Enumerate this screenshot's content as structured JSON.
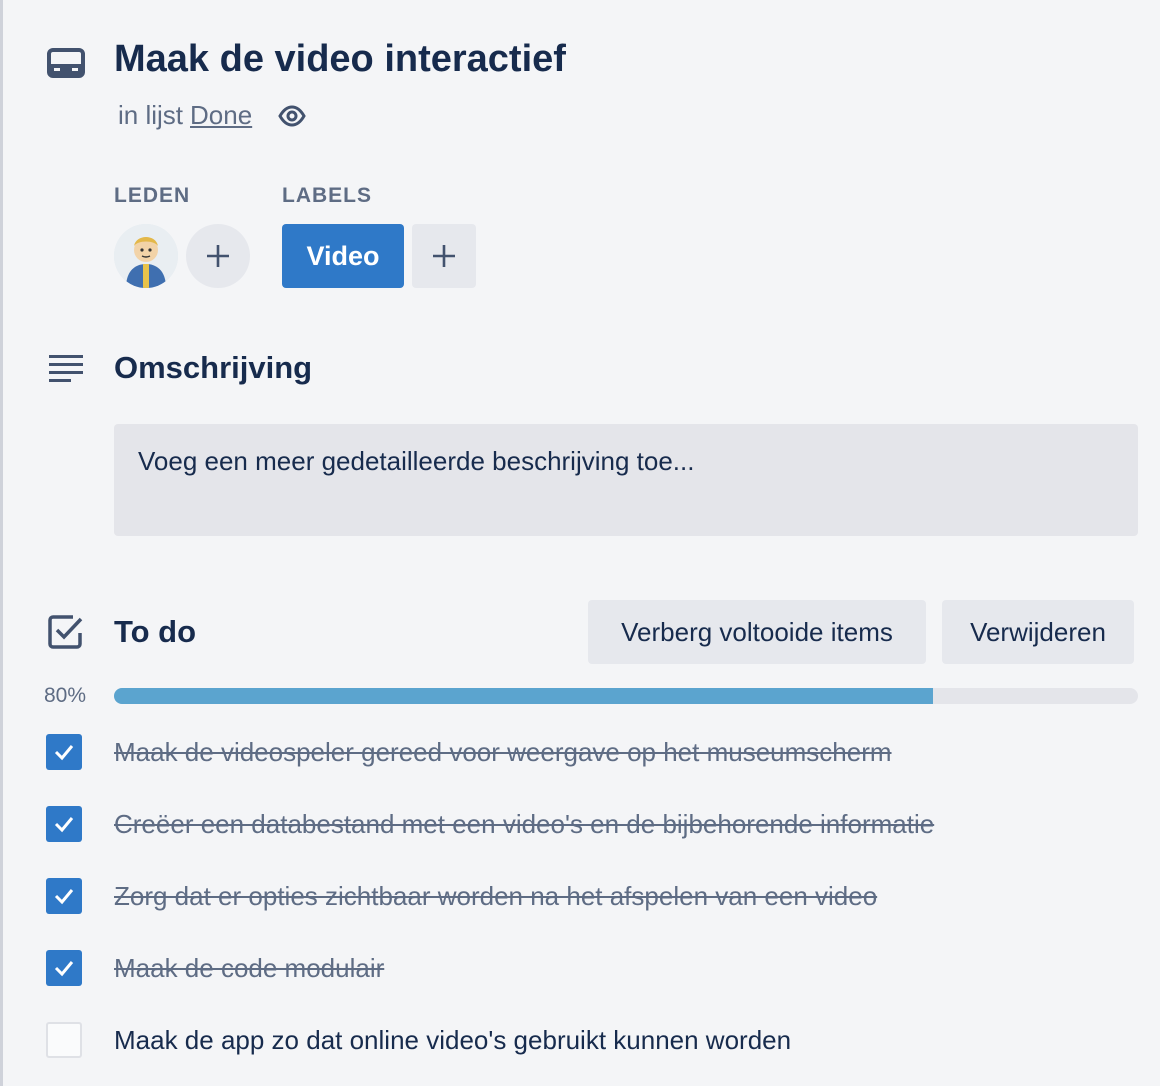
{
  "card": {
    "title": "Maak de video interactief",
    "list_prefix": "in lijst",
    "list_name": "Done"
  },
  "members": {
    "label": "LEDEN"
  },
  "labels": {
    "label": "LABELS",
    "items": [
      {
        "name": "Video",
        "color": "#2f79c8"
      }
    ]
  },
  "description": {
    "heading": "Omschrijving",
    "placeholder": "Voeg een meer gedetailleerde beschrijving toe..."
  },
  "checklist": {
    "title": "To do",
    "hide_button": "Verberg voltooide items",
    "delete_button": "Verwijderen",
    "progress_label": "80%",
    "progress": 0.8,
    "items": [
      {
        "text": "Maak de videospeler gereed voor weergave op het museumscherm",
        "checked": true
      },
      {
        "text": "Creëer een databestand met een video's en de bijbehorende informatie",
        "checked": true
      },
      {
        "text": "Zorg dat er opties zichtbaar worden na het afspelen van een video",
        "checked": true
      },
      {
        "text": "Maak de code modulair",
        "checked": true
      },
      {
        "text": "Maak de app zo dat online video's gebruikt kunnen worden",
        "checked": false
      }
    ]
  },
  "icons": {
    "card": "card-icon",
    "watch": "eye-icon",
    "description": "description-lines-icon",
    "checklist": "checklist-icon",
    "add": "plus-icon"
  },
  "colors": {
    "primary": "#2f79c8",
    "progress": "#5ba4cf",
    "text": "#172b4d",
    "muted": "#5e6c84",
    "background": "#f4f5f7"
  }
}
